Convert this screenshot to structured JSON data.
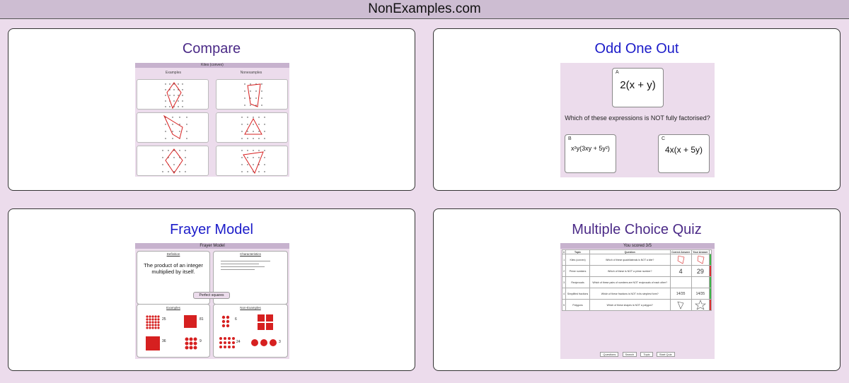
{
  "site": {
    "title": "NonExamples.com"
  },
  "cards": {
    "compare": {
      "title": "Compare",
      "preview": {
        "header": "Kites (convex)",
        "col_examples": "Examples",
        "col_nonexamples": "Nonexamples"
      }
    },
    "odd_one_out": {
      "title": "Odd One Out",
      "preview": {
        "options": [
          {
            "letter": "A",
            "expr": "2(x + y)"
          },
          {
            "letter": "B",
            "expr": "x²y(3xy + 5y²)"
          },
          {
            "letter": "C",
            "expr": "4x(x + 5y)"
          }
        ],
        "question": "Which of these expressions is NOT fully factorised?"
      }
    },
    "frayer": {
      "title": "Frayer Model",
      "preview": {
        "header": "Frayer Model",
        "definition_label": "Definition",
        "characteristics_label": "Characteristics",
        "examples_label": "Examples",
        "nonexamples_label": "Non-Examples",
        "center": "Perfect squares",
        "definition_text": "The product of an integer multiplied by itself.",
        "example_numbers": [
          "25",
          "81",
          "36",
          "9"
        ],
        "nonexample_numbers": [
          "6",
          "24",
          "3"
        ]
      }
    },
    "quiz": {
      "title": "Multiple Choice Quiz",
      "preview": {
        "score": "You scored 3/5",
        "columns": [
          "#",
          "Topic",
          "Question",
          "Correct Answer",
          "Your Answer"
        ],
        "rows": [
          {
            "n": "1",
            "topic": "Kites (convex)",
            "question": "Which of these quadrilaterals is NOT a kite?",
            "correct": "",
            "yours": "",
            "status": "ok"
          },
          {
            "n": "2",
            "topic": "Prime numbers",
            "question": "Which of these is NOT a prime number?",
            "correct": "4",
            "yours": "29",
            "status": "bad"
          },
          {
            "n": "3",
            "topic": "Reciprocals",
            "question": "Which of these pairs of numbers are NOT reciprocals of each other?",
            "correct": "",
            "yours": "",
            "status": "ok"
          },
          {
            "n": "4",
            "topic": "Simplified fractions",
            "question": "Which of these fractions is NOT in its simplest form?",
            "correct": "14/35",
            "yours": "14/35",
            "status": "ok"
          },
          {
            "n": "5",
            "topic": "Polygons",
            "question": "Which of these shapes is NOT a polygon?",
            "correct": "",
            "yours": "",
            "status": "bad"
          }
        ],
        "footer": [
          "Questions",
          "Search",
          "Topic",
          "Start Quiz"
        ]
      }
    }
  },
  "colors": {
    "accent_purple": "#4b2a87",
    "accent_blue": "#1b1bc9",
    "page_bg": "#ecdcec",
    "shape_red": "#d62020"
  }
}
